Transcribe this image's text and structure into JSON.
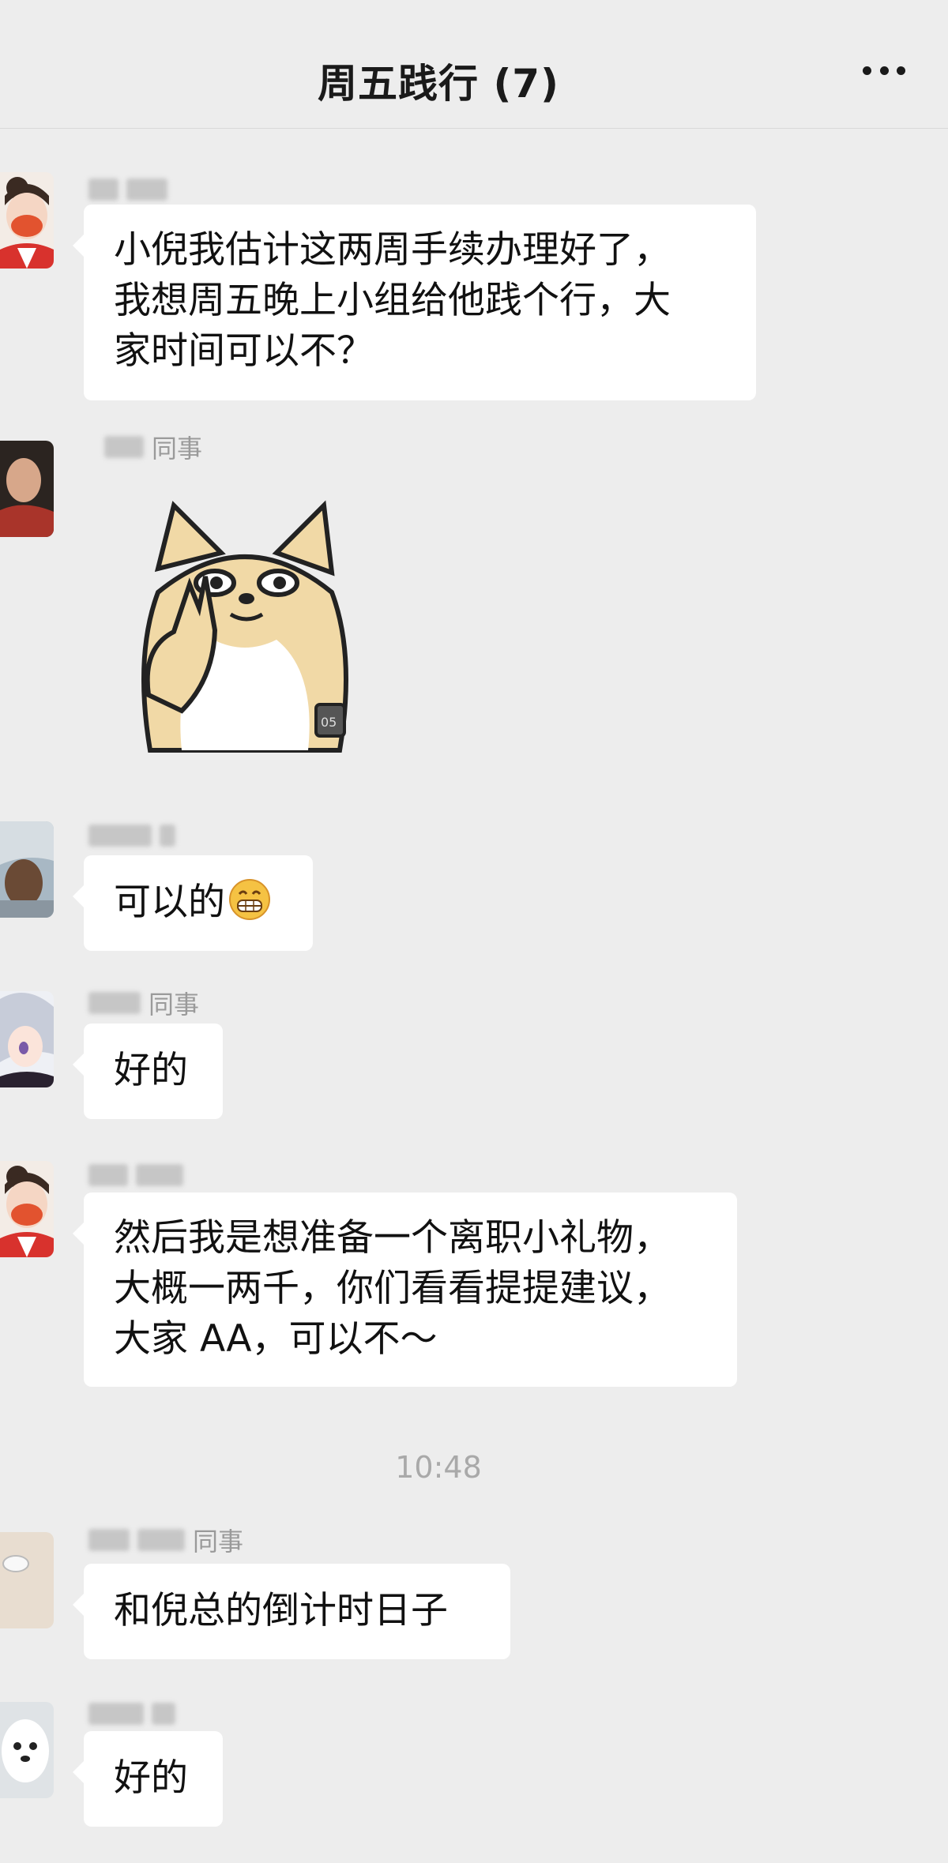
{
  "chat": {
    "title": "周五践行 (7)",
    "more_icon": "more-icon"
  },
  "messages": [
    {
      "sender_suffix": "",
      "lines": [
        "小倪我估计这两周手续办理好了，",
        "我想周五晚上小组给他践个行，大",
        "家时间可以不？"
      ]
    },
    {
      "sender_suffix": "同事",
      "sticker": "shiba-dog-ok-sticker",
      "sticker_tag": "05"
    },
    {
      "sender_suffix": "",
      "lines": [
        "可以的"
      ],
      "emoji": "grinning-face-emoji"
    },
    {
      "sender_suffix": "同事",
      "lines": [
        "好的"
      ]
    },
    {
      "sender_suffix": "",
      "lines": [
        "然后我是想准备一个离职小礼物，",
        "大概一两千，你们看看提提建议，",
        "大家 AA，可以不～"
      ]
    },
    {
      "sender_suffix": "同事",
      "lines": [
        "和倪总的倒计时日子"
      ]
    },
    {
      "sender_suffix": "",
      "lines": [
        "好的"
      ]
    }
  ],
  "timestamp": "10:48",
  "colors": {
    "background": "#ededed",
    "bubble": "#ffffff",
    "timestamp": "#a9a9a9"
  }
}
